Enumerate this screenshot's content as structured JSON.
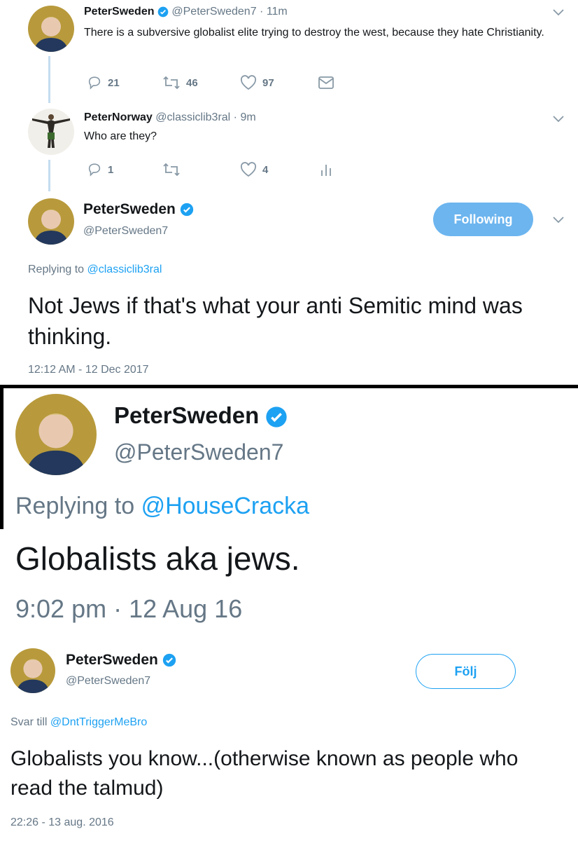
{
  "tweet1": {
    "name": "PeterSweden",
    "handle": "@PeterSweden7",
    "time": "· 11m",
    "text": "There is a subversive globalist elite trying to destroy the west, because they hate Christianity.",
    "replies": "21",
    "retweets": "46",
    "likes": "97"
  },
  "tweet2": {
    "name": "PeterNorway",
    "handle": "@classiclib3ral",
    "time": "· 9m",
    "text": "Who are they?",
    "replies": "1",
    "retweets": "",
    "likes": "4"
  },
  "tweet3": {
    "name": "PeterSweden",
    "handle": "@PeterSweden7",
    "follow_label": "Following",
    "replying_prefix": "Replying to",
    "replying_to": "@classiclib3ral",
    "text": "Not Jews if that's what your anti Semitic mind was thinking.",
    "timestamp": "12:12 AM - 12 Dec 2017"
  },
  "tweet4": {
    "name": "PeterSweden",
    "handle": "@PeterSweden7",
    "replying_prefix": "Replying to",
    "replying_to": "@HouseCracka",
    "text": "Globalists aka jews.",
    "timestamp": "9:02 pm · 12 Aug 16"
  },
  "tweet5": {
    "name": "PeterSweden",
    "handle": "@PeterSweden7",
    "follow_label": "Följ",
    "replying_prefix": "Svar till",
    "replying_to": "@DntTriggerMeBro",
    "text": "Globalists you know...(otherwise known as people who read the talmud)",
    "timestamp": "22:26 - 13 aug. 2016"
  },
  "icons": {
    "reply": "reply-icon",
    "retweet": "retweet-icon",
    "like": "heart-icon",
    "dm": "envelope-icon",
    "analytics": "analytics-icon",
    "verified": "verified-badge-icon",
    "more": "chevron-down-icon"
  },
  "colors": {
    "accent": "#1da1f2",
    "muted": "#657786",
    "following_bg": "#6cb5ef"
  }
}
